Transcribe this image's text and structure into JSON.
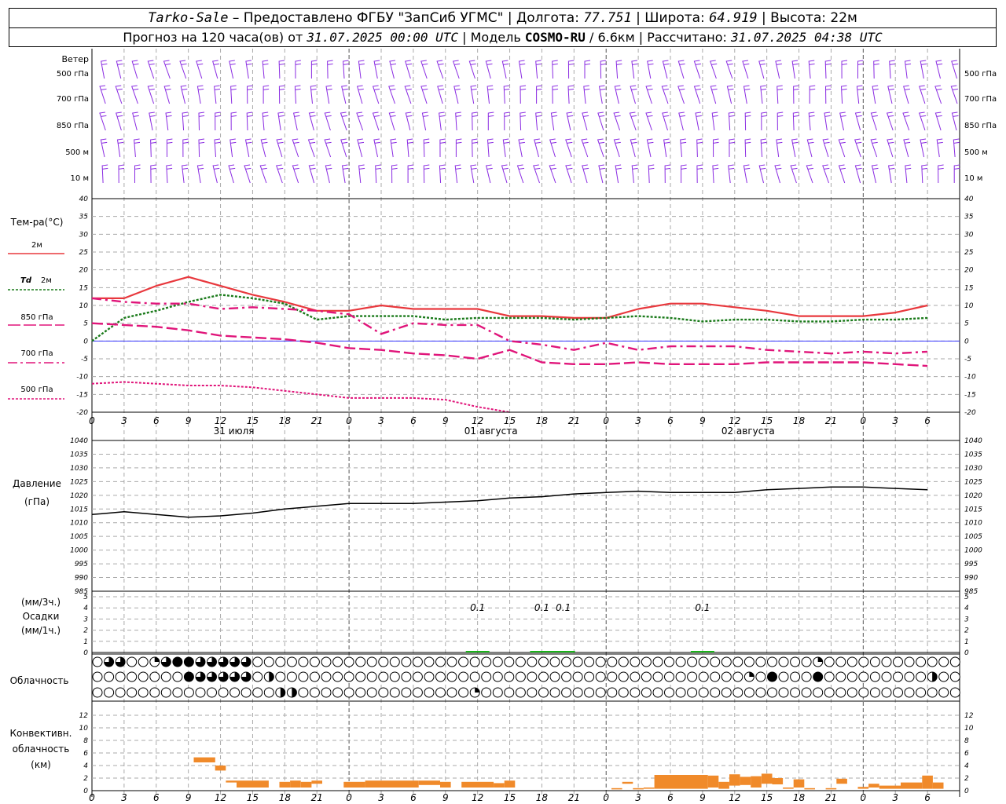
{
  "header": {
    "station": "Tarko-Sale",
    "provider": " – Предоставлено ФГБУ \"ЗапСиб УГМС\" | Долгота: ",
    "lon": "77.751",
    "lat_label": " | Широта: ",
    "lat": "64.919",
    "alt_label": " | Высота: ",
    "alt": "22м",
    "forecast_label": "Прогноз на 120 часа(ов) от ",
    "forecast_time": "31.07.2025 00:00 UTC",
    "model_label": "  | Модель ",
    "model": "COSMO-RU",
    "res": " / 6.6км",
    "calc_label": " | Рассчитано: ",
    "calc_time": "31.07.2025 04:38 UTC"
  },
  "labels": {
    "wind": "Ветер",
    "wind_levels": [
      "500 гПа",
      "700 гПа",
      "850 гПа",
      "500 м",
      "10  м"
    ],
    "temp": "Тем-ра(°С)",
    "t2m": "2м",
    "td_a": "Td",
    "td_b": "2м",
    "t850": "850 гПа",
    "t700": "700 гПа",
    "t500": "500 гПа",
    "press_a": "Давление",
    "press_b": "(гПа)",
    "precip_a": "(мм/3ч.)",
    "precip_b": "Осадки",
    "precip_c": "(мм/1ч.)",
    "cloud": "Облачность",
    "conv_a": "Конвективн.",
    "conv_b": "облачность",
    "conv_c": "(км)",
    "day1": "31 июля",
    "day2": "01 августа",
    "day3": "02 августа"
  },
  "colors": {
    "wind": "#8a2be2",
    "t2m": "#e8383d",
    "td": "#1a7a1a",
    "t_upper": "#e0157a",
    "zero": "#3a3aff",
    "conv": "#f08a2a",
    "precip": "#19b319"
  },
  "hour_ticks": [
    "0",
    "3",
    "6",
    "9",
    "12",
    "15",
    "18",
    "21",
    "0",
    "3",
    "6",
    "9",
    "12",
    "15",
    "18",
    "21",
    "0",
    "3",
    "6",
    "9",
    "12",
    "15",
    "18",
    "21",
    "0",
    "3",
    "6"
  ],
  "chart_data": [
    {
      "type": "line",
      "title": "Тем-ра(°С)",
      "ylim": [
        -20,
        40
      ],
      "yticks": [
        "40",
        "35",
        "30",
        "25",
        "20",
        "15",
        "10",
        "5",
        "0",
        "-5",
        "-10",
        "-15",
        "-20"
      ],
      "x_hours": [
        0,
        3,
        6,
        9,
        12,
        15,
        18,
        21,
        24,
        27,
        30,
        33,
        36,
        39,
        42,
        45,
        48,
        51,
        54,
        57,
        60,
        63,
        66,
        69,
        72,
        75,
        78
      ],
      "series": [
        {
          "name": "2м",
          "values": [
            12,
            12,
            15.5,
            18,
            15.5,
            13,
            11,
            8.5,
            8.5,
            10,
            9,
            9,
            9,
            7,
            7,
            6.5,
            6.5,
            9,
            10.5,
            10.5,
            9.5,
            8.5,
            7,
            7,
            7,
            8,
            10
          ]
        },
        {
          "name": "Td 2м",
          "values": [
            0,
            6.5,
            8.5,
            11,
            13,
            12,
            10.5,
            6,
            7,
            7,
            7,
            6,
            6.5,
            6.5,
            6.5,
            6,
            6.5,
            7,
            6.5,
            5.5,
            6,
            6,
            5.5,
            5.5,
            6,
            6,
            6.5
          ]
        },
        {
          "name": "850 гПа",
          "values": [
            5,
            4.5,
            4,
            3,
            1.5,
            1,
            0.5,
            -0.5,
            -2,
            -2.5,
            -3.5,
            -4,
            -5,
            -2.5,
            -6,
            -6.5,
            -6.5,
            -6,
            -6.5,
            -6.5,
            -6.5,
            -6,
            -6,
            -6,
            -6,
            -6.5,
            -7
          ]
        },
        {
          "name": "700 гПа",
          "values": [
            12,
            11,
            10.5,
            10.5,
            9,
            9.5,
            9,
            8.5,
            7.5,
            2,
            5,
            4.5,
            4.5,
            0,
            -1,
            -2.5,
            -0.5,
            -2.5,
            -1.5,
            -1.5,
            -1.5,
            -2.5,
            -3,
            -3.5,
            -3,
            -3.5,
            -3
          ]
        },
        {
          "name": "500 гПа",
          "values": [
            -12,
            -11.5,
            -12,
            -12.5,
            -12.5,
            -13,
            -14,
            -15,
            -16,
            -16,
            -16,
            -16.5,
            -18.5,
            -20.5
          ]
        }
      ]
    },
    {
      "type": "line",
      "title": "Давление (гПа)",
      "ylim": [
        985,
        1040
      ],
      "yticks": [
        "1040",
        "1035",
        "1030",
        "1025",
        "1020",
        "1015",
        "1010",
        "1005",
        "1000",
        "995",
        "990",
        "985"
      ],
      "x_hours": [
        0,
        3,
        6,
        9,
        12,
        15,
        18,
        21,
        24,
        27,
        30,
        33,
        36,
        39,
        42,
        45,
        48,
        51,
        54,
        57,
        60,
        63,
        66,
        69,
        72,
        75,
        78
      ],
      "series": [
        {
          "name": "Давление",
          "values": [
            1013,
            1014,
            1013,
            1012,
            1012.5,
            1013.5,
            1015,
            1016,
            1017,
            1017,
            1017,
            1017.5,
            1018,
            1019,
            1019.5,
            1020.5,
            1021,
            1021.5,
            1021,
            1021,
            1021,
            1022,
            1022.5,
            1023,
            1023,
            1022.5,
            1022
          ]
        }
      ]
    },
    {
      "type": "bar",
      "title": "Осадки",
      "ylim": [
        0,
        5
      ],
      "yticks": [
        "5",
        "4",
        "3",
        "2",
        "1",
        "0"
      ],
      "x_hours": [
        36,
        42,
        44,
        57
      ],
      "values": [
        0.1,
        0.1,
        0.1,
        0.1
      ],
      "labels": [
        "0.1",
        "0.1",
        "0.1",
        "0.1"
      ]
    },
    {
      "type": "bar",
      "title": "Конвективн. облачность (км)",
      "ylim": [
        0,
        14
      ],
      "yticks": [
        "12",
        "10",
        "8",
        "6",
        "4",
        "2",
        "0"
      ],
      "segments": [
        {
          "h0": 9.5,
          "h1": 11.5,
          "bottom": 4.5,
          "top": 5.3
        },
        {
          "h0": 11.5,
          "h1": 12.5,
          "bottom": 3.2,
          "top": 4.0
        },
        {
          "h0": 12.5,
          "h1": 13.5,
          "bottom": 1.3,
          "top": 1.6
        },
        {
          "h0": 13.5,
          "h1": 16.5,
          "bottom": 0.5,
          "top": 1.6
        },
        {
          "h0": 17.5,
          "h1": 18.5,
          "bottom": 0.5,
          "top": 1.4
        },
        {
          "h0": 18.5,
          "h1": 19.5,
          "bottom": 0.5,
          "top": 1.6
        },
        {
          "h0": 19.5,
          "h1": 20.5,
          "bottom": 0.5,
          "top": 1.4
        },
        {
          "h0": 20.5,
          "h1": 21.5,
          "bottom": 1.1,
          "top": 1.6
        },
        {
          "h0": 23.5,
          "h1": 25.5,
          "bottom": 0.5,
          "top": 1.4
        },
        {
          "h0": 25.5,
          "h1": 30.5,
          "bottom": 0.5,
          "top": 1.6
        },
        {
          "h0": 30.5,
          "h1": 32.5,
          "bottom": 0.9,
          "top": 1.6
        },
        {
          "h0": 32.5,
          "h1": 33.5,
          "bottom": 0.5,
          "top": 1.4
        },
        {
          "h0": 34.5,
          "h1": 37.5,
          "bottom": 0.5,
          "top": 1.4
        },
        {
          "h0": 37.5,
          "h1": 38.5,
          "bottom": 0.5,
          "top": 1.2
        },
        {
          "h0": 38.5,
          "h1": 39.5,
          "bottom": 0.5,
          "top": 1.6
        },
        {
          "h0": 48.5,
          "h1": 49.5,
          "bottom": 0.2,
          "top": 0.4
        },
        {
          "h0": 49.5,
          "h1": 50.5,
          "bottom": 1.1,
          "top": 1.4
        },
        {
          "h0": 50.5,
          "h1": 51.5,
          "bottom": 0.2,
          "top": 0.4
        },
        {
          "h0": 51.5,
          "h1": 52.5,
          "bottom": 0.3,
          "top": 0.5
        },
        {
          "h0": 52.5,
          "h1": 57.5,
          "bottom": 0.3,
          "top": 2.5
        },
        {
          "h0": 57.5,
          "h1": 58.5,
          "bottom": 0.5,
          "top": 2.4
        },
        {
          "h0": 58.5,
          "h1": 59.5,
          "bottom": 0.3,
          "top": 1.4
        },
        {
          "h0": 59.5,
          "h1": 60.5,
          "bottom": 0.8,
          "top": 2.6
        },
        {
          "h0": 60.5,
          "h1": 61.5,
          "bottom": 0.9,
          "top": 2.2
        },
        {
          "h0": 61.5,
          "h1": 62.5,
          "bottom": 0.5,
          "top": 2.3
        },
        {
          "h0": 62.5,
          "h1": 63.5,
          "bottom": 1.1,
          "top": 2.7
        },
        {
          "h0": 63.5,
          "h1": 64.5,
          "bottom": 1.0,
          "top": 2.0
        },
        {
          "h0": 64.5,
          "h1": 65.5,
          "bottom": 0.3,
          "top": 0.5
        },
        {
          "h0": 65.5,
          "h1": 66.5,
          "bottom": 0.5,
          "top": 1.8
        },
        {
          "h0": 66.5,
          "h1": 67.5,
          "bottom": 0.2,
          "top": 0.4
        },
        {
          "h0": 68.5,
          "h1": 69.5,
          "bottom": 0.2,
          "top": 0.4
        },
        {
          "h0": 69.5,
          "h1": 70.5,
          "bottom": 1.1,
          "top": 1.9
        },
        {
          "h0": 71.5,
          "h1": 72.5,
          "bottom": 0.3,
          "top": 0.6
        },
        {
          "h0": 72.5,
          "h1": 73.5,
          "bottom": 0.5,
          "top": 1.1
        },
        {
          "h0": 73.5,
          "h1": 75.5,
          "bottom": 0.3,
          "top": 0.8
        },
        {
          "h0": 75.5,
          "h1": 77.5,
          "bottom": 0.3,
          "top": 1.3
        },
        {
          "h0": 77.5,
          "h1": 78.5,
          "bottom": 0.3,
          "top": 2.4
        },
        {
          "h0": 78.5,
          "h1": 79.5,
          "bottom": 0.3,
          "top": 1.3
        }
      ]
    }
  ],
  "cloud_rows": {
    "high": "0330013443333300000000000000000000000000000000000000000000000001000000000000",
    "mid": "0000000043333302000000000000000000000000000000000000000001040004000000000200",
    "low": "0000000000000000220000000000000001000000000000000000000000000000000000000000"
  },
  "wind_row_count": 5
}
